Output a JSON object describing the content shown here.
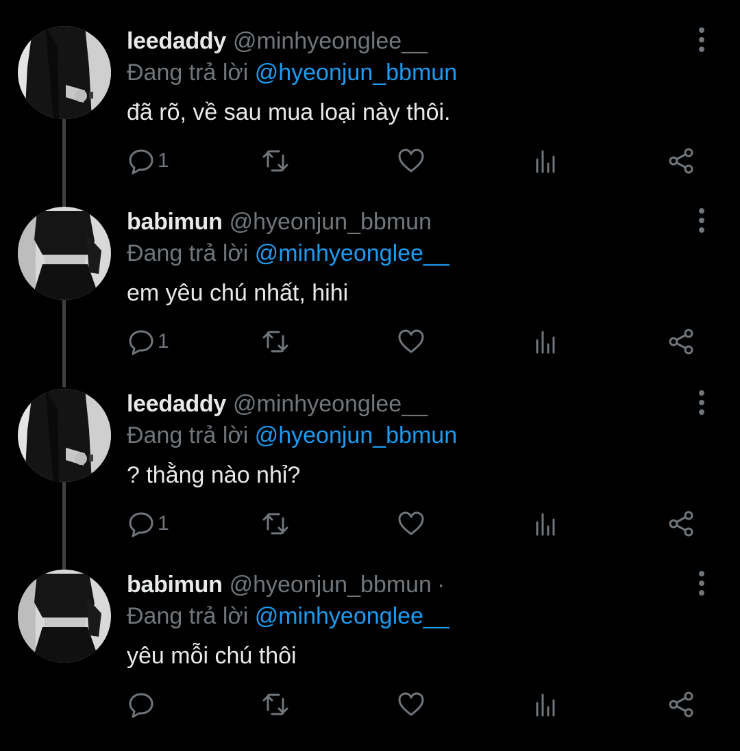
{
  "reply_prefix": "Đang trả lời",
  "tweets": [
    {
      "display_name": "leedaddy",
      "handle": "@minhyeonglee__",
      "separator": "",
      "reply_to": "@hyeonjun_bbmun",
      "text": "đã rõ, về sau mua loại này thôi.",
      "reply_count": "1",
      "avatar": "man-in-black-shirt"
    },
    {
      "display_name": "babimun",
      "handle": "@hyeonjun_bbmun",
      "separator": "",
      "reply_to": "@minhyeonglee__",
      "text": "em yêu chú nhất, hihi",
      "reply_count": "1",
      "avatar": "girl-in-black-outfit"
    },
    {
      "display_name": "leedaddy",
      "handle": "@minhyeonglee__",
      "separator": "",
      "reply_to": "@hyeonjun_bbmun",
      "text": "? thằng nào nhỉ?",
      "reply_count": "1",
      "avatar": "man-in-black-shirt"
    },
    {
      "display_name": "babimun",
      "handle": "@hyeonjun_bbmun",
      "separator": "·",
      "reply_to": "@minhyeonglee__",
      "text": "yêu mỗi chú thôi",
      "reply_count": "",
      "avatar": "girl-in-black-outfit"
    }
  ],
  "colors": {
    "background": "#000000",
    "text": "#e7e9ea",
    "muted": "#71767b",
    "mention": "#1d9bf0",
    "thread_line": "#3e4144"
  },
  "icons": [
    "reply-icon",
    "retweet-icon",
    "like-icon",
    "views-icon",
    "share-icon",
    "more-options-icon"
  ]
}
